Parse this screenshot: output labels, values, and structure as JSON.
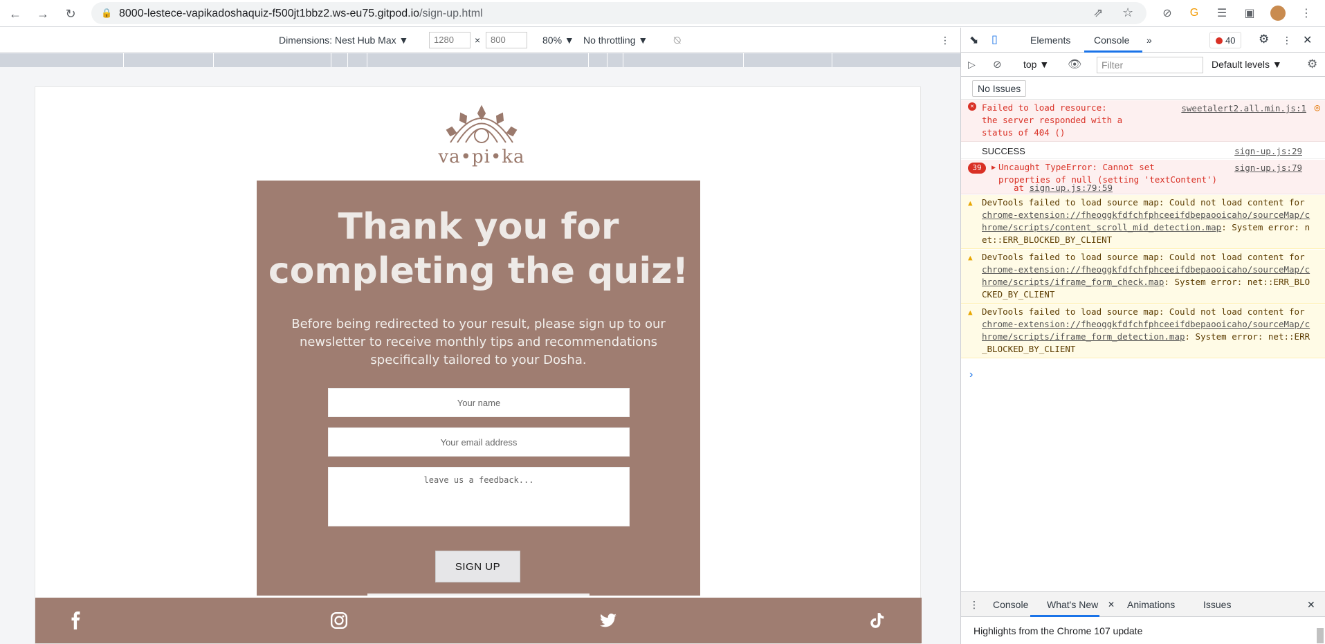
{
  "browser": {
    "url_main": "8000-lestece-vapikadoshaquiz-f500jt1bbz2.ws-eu75.gitpod.io",
    "url_path": "/sign-up.html"
  },
  "device_toolbar": {
    "dimensions_label": "Dimensions: Nest Hub Max",
    "width": "1280",
    "times": "×",
    "height": "800",
    "zoom": "80%",
    "throttling": "No throttling"
  },
  "page": {
    "logo_text": "va•pi•ka",
    "heading": "Thank you for completing the quiz!",
    "subtitle": "Before being redirected to your result, please sign up to our newsletter to receive monthly tips and recommendations specifically tailored to your Dosha.",
    "name_placeholder": "Your name",
    "email_placeholder": "Your email address",
    "feedback_placeholder": "leave us a feedback...",
    "signup_label": "SIGN UP",
    "social": [
      "facebook",
      "instagram",
      "twitter",
      "tiktok"
    ]
  },
  "devtools": {
    "tabs": {
      "elements": "Elements",
      "console": "Console"
    },
    "error_count": "40",
    "context": "top",
    "filter_placeholder": "Filter",
    "levels": "Default levels",
    "no_issues": "No Issues",
    "messages": [
      {
        "type": "error",
        "text": "Failed to load resource:\nthe server responded with a\nstatus of 404 ()",
        "source": "sweetalert2.all.min.js:1"
      },
      {
        "type": "info",
        "text": "SUCCESS",
        "source": "sign-up.js:29"
      },
      {
        "type": "error",
        "count": "39",
        "text": "Uncaught TypeError: Cannot set\nproperties of null (setting 'textContent')",
        "at": "at ",
        "at_link": "sign-up.js:79:59",
        "source": "sign-up.js:79"
      },
      {
        "type": "warn",
        "text_a": "DevTools failed to load source map: Could not load content for ",
        "link": "chrome-extension://fheoggkfdfchfphceeifdbepaooicaho/sourceMap/chrome/scripts/content_scroll_mid_detection.map",
        "text_b": ": System error: net::ERR_BLOCKED_BY_CLIENT"
      },
      {
        "type": "warn",
        "text_a": "DevTools failed to load source map: Could not load content for ",
        "link": "chrome-extension://fheoggkfdfchfphceeifdbepaooicaho/sourceMap/chrome/scripts/iframe_form_check.map",
        "text_b": ": System error: net::ERR_BLOCKED_BY_CLIENT"
      },
      {
        "type": "warn",
        "text_a": "DevTools failed to load source map: Could not load content for ",
        "link": "chrome-extension://fheoggkfdfchfphceeifdbepaooicaho/sourceMap/chrome/scripts/iframe_form_detection.map",
        "text_b": ": System error: net::ERR_BLOCKED_BY_CLIENT"
      }
    ],
    "drawer": {
      "tabs": [
        "Console",
        "What's New",
        "Animations",
        "Issues"
      ],
      "highlights": "Highlights from the Chrome 107 update"
    }
  }
}
